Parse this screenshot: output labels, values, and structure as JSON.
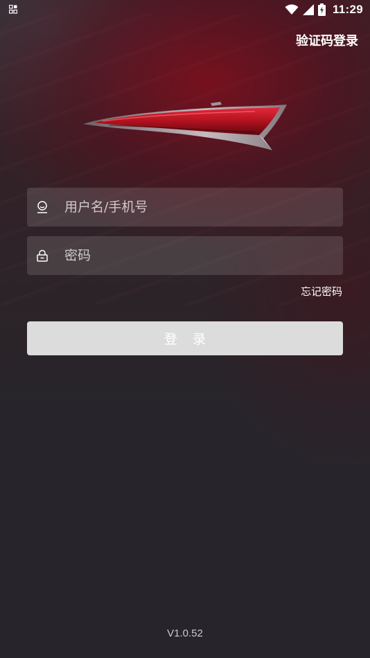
{
  "status_bar": {
    "time": "11:29",
    "icons": [
      "app-notification-icon",
      "wifi-icon",
      "cell-signal-icon",
      "battery-icon"
    ]
  },
  "header": {
    "sms_login_label": "验证码登录"
  },
  "brand": {
    "logo_icon": "car-logo",
    "accent_color": "#b0121e"
  },
  "form": {
    "username": {
      "placeholder": "用户名/手机号",
      "value": "",
      "icon": "user-icon"
    },
    "password": {
      "placeholder": "密码",
      "value": "",
      "icon": "lock-icon"
    },
    "forgot_password_label": "忘记密码",
    "login_button_label": "登录",
    "login_button_color": "#dcdcdc"
  },
  "footer": {
    "version": "V1.0.52"
  }
}
